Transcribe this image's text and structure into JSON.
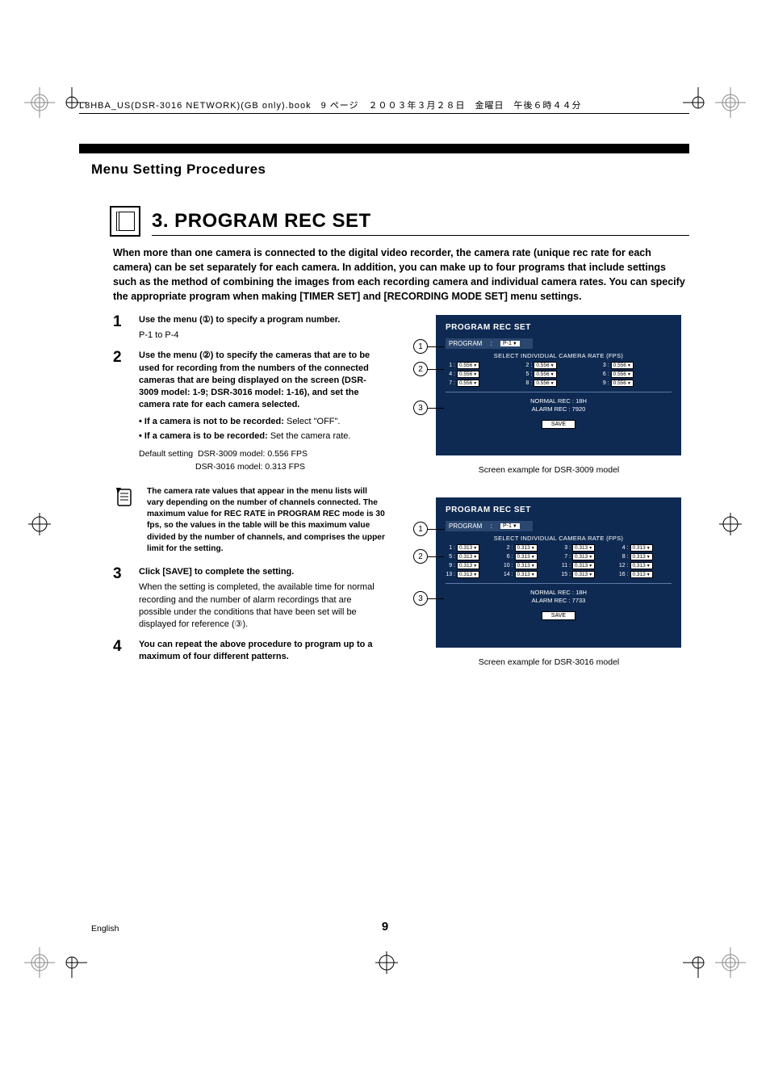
{
  "header_line": "L8HBA_US(DSR-3016 NETWORK)(GB only).book　9 ページ　２００３年３月２８日　金曜日　午後６時４４分",
  "section_title": "Menu Setting Procedures",
  "chapter_title": "3.  PROGRAM REC SET",
  "intro": "When more than one camera is connected to the digital video recorder, the camera rate (unique rec rate for each camera) can be set separately for each camera. In addition, you can make up to four programs that include settings such as the method of combining the images from each recording camera and individual camera rates. You can specify the appropriate program when making [TIMER SET] and [RECORDING MODE SET] menu settings.",
  "steps": {
    "s1": {
      "num": "1",
      "lead": "Use the menu (①) to specify a program number.",
      "sub": "P-1 to P-4"
    },
    "s2": {
      "num": "2",
      "lead": "Use the menu (②) to specify the cameras that are to be used for recording from the numbers of the connected cameras that are being displayed on the screen (DSR-3009 model: 1-9; DSR-3016 model: 1-16), and set the camera rate for each camera selected.",
      "b1": "If a camera is not to be recorded:",
      "b1v": " Select \"OFF\".",
      "b2": "If a camera is to be recorded:",
      "b2v": " Set the camera rate.",
      "def_lbl": "Default setting",
      "def1": "DSR-3009 model: 0.556 FPS",
      "def2": "DSR-3016 model: 0.313 FPS"
    },
    "note": "The camera rate values that appear in the menu lists will vary depending on the number of channels connected. The maximum value for REC RATE in PROGRAM REC mode is 30 fps, so the values in the table will be this maximum value divided by the number of channels, and comprises the upper limit for the setting.",
    "s3": {
      "num": "3",
      "lead": "Click [SAVE] to complete the setting.",
      "sub": "When the setting is completed, the available time for normal recording and the number of alarm recordings that are possible under the conditions that have been set will be displayed for reference (③)."
    },
    "s4": {
      "num": "4",
      "lead": "You can repeat the above procedure to program up to a maximum of four different patterns."
    }
  },
  "screen_common": {
    "title": "PROGRAM REC SET",
    "prog_label": "PROGRAM",
    "prog_value": "P-1",
    "subheader": "SELECT INDIVIDUAL CAMERA RATE (FPS)",
    "info1": "NORMAL REC : 18H",
    "info2": "ALARM REC : 7920",
    "save": "SAVE"
  },
  "screen_3009": {
    "rate": "0.556",
    "caption": "Screen example for DSR-3009 model"
  },
  "screen_3016": {
    "rate": "0.313",
    "info2": "ALARM REC : 7733",
    "caption": "Screen example for DSR-3016 model"
  },
  "footer": {
    "lang": "English",
    "pg": "9"
  },
  "chart_data": {
    "type": "table",
    "title": "PROGRAM REC SET default camera rates",
    "series": [
      {
        "name": "DSR-3009",
        "channels": [
          1,
          2,
          3,
          4,
          5,
          6,
          7,
          8,
          9
        ],
        "rate_fps": 0.556
      },
      {
        "name": "DSR-3016",
        "channels": [
          1,
          2,
          3,
          4,
          5,
          6,
          7,
          8,
          9,
          10,
          11,
          12,
          13,
          14,
          15,
          16
        ],
        "rate_fps": 0.313
      }
    ],
    "normal_rec_hours": 18,
    "alarm_rec": {
      "DSR-3009": 7920,
      "DSR-3016": 7733
    }
  }
}
